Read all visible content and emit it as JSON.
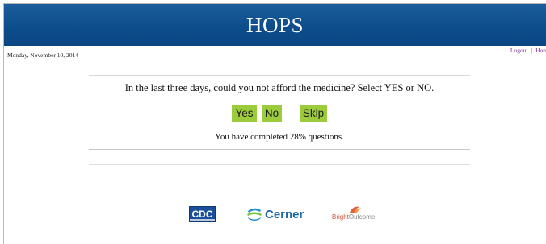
{
  "header": {
    "title": "HOPS"
  },
  "date": "Monday, November 10, 2014",
  "links": {
    "logout": "Logout",
    "separator": "|",
    "home": "Hon"
  },
  "survey": {
    "question": "In the last three days, could you not afford the medicine? Select YES or NO.",
    "answers": {
      "yes": "Yes",
      "no": "No",
      "skip": "Skip"
    },
    "progress": "You have completed 28% questions.",
    "answer_color": "#9ccb3b"
  },
  "footer_logos": {
    "cdc": "CDC",
    "cerner": "Cerner",
    "brightoutcome_a": "Bright",
    "brightoutcome_b": "Outcome"
  },
  "colors": {
    "header": "#0d4d8b",
    "link": "#7a2a8c"
  }
}
